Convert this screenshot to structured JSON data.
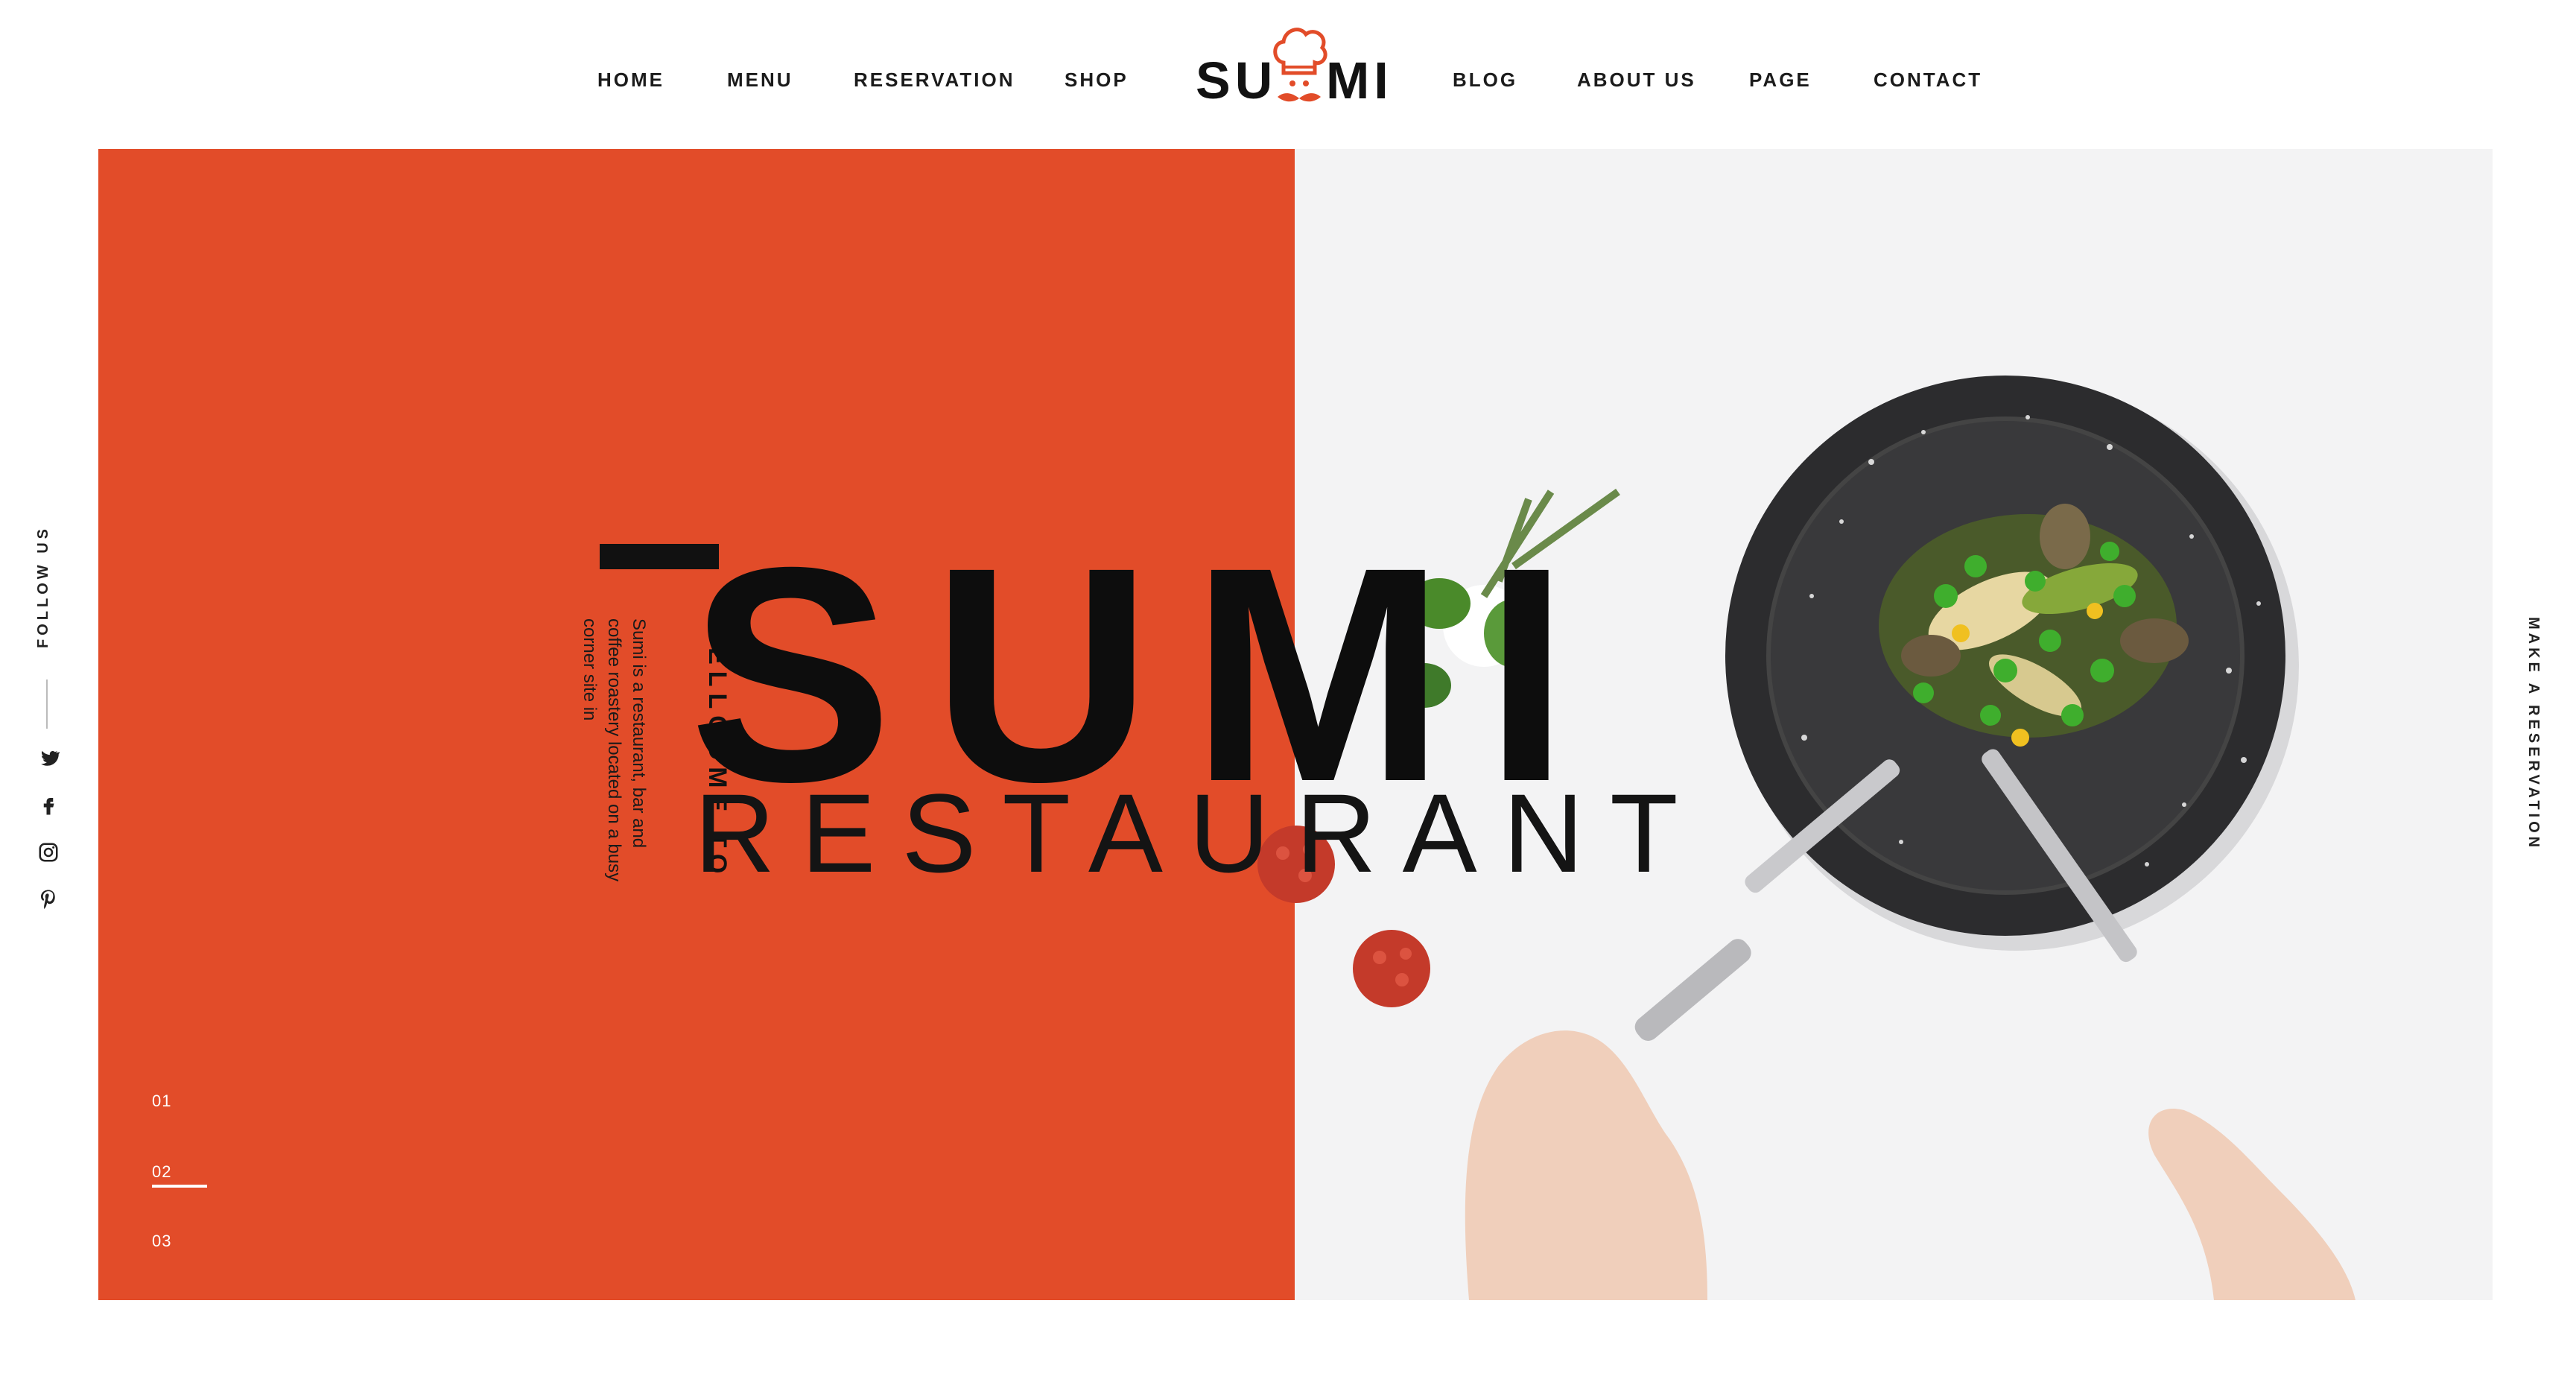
{
  "nav": {
    "home": "HOME",
    "menu": "MENU",
    "reservation": "RESERVATION",
    "shop": "SHOP",
    "blog": "BLOG",
    "about": "ABOUT US",
    "page": "PAGE",
    "contact": "CONTACT"
  },
  "logo": {
    "left": "SU",
    "right": "MI"
  },
  "hero": {
    "welcome": "WELLCOME TO",
    "intro": "Sumi is a restaurant, bar and coffee roastery located on a busy corner site in",
    "title": "SUMI",
    "subtitle": "RESTAURANT",
    "slides": [
      "01",
      "02",
      "03"
    ],
    "active_slide": "02"
  },
  "sidebar": {
    "follow": "FOLLOW US",
    "social_icons": [
      "twitter-icon",
      "facebook-icon",
      "instagram-icon",
      "pinterest-icon"
    ]
  },
  "right_rail": {
    "reservation": "MAKE A RESERVATION"
  },
  "colors": {
    "accent": "#e24c29",
    "dark": "#111111",
    "panel": "#f3f3f4"
  }
}
